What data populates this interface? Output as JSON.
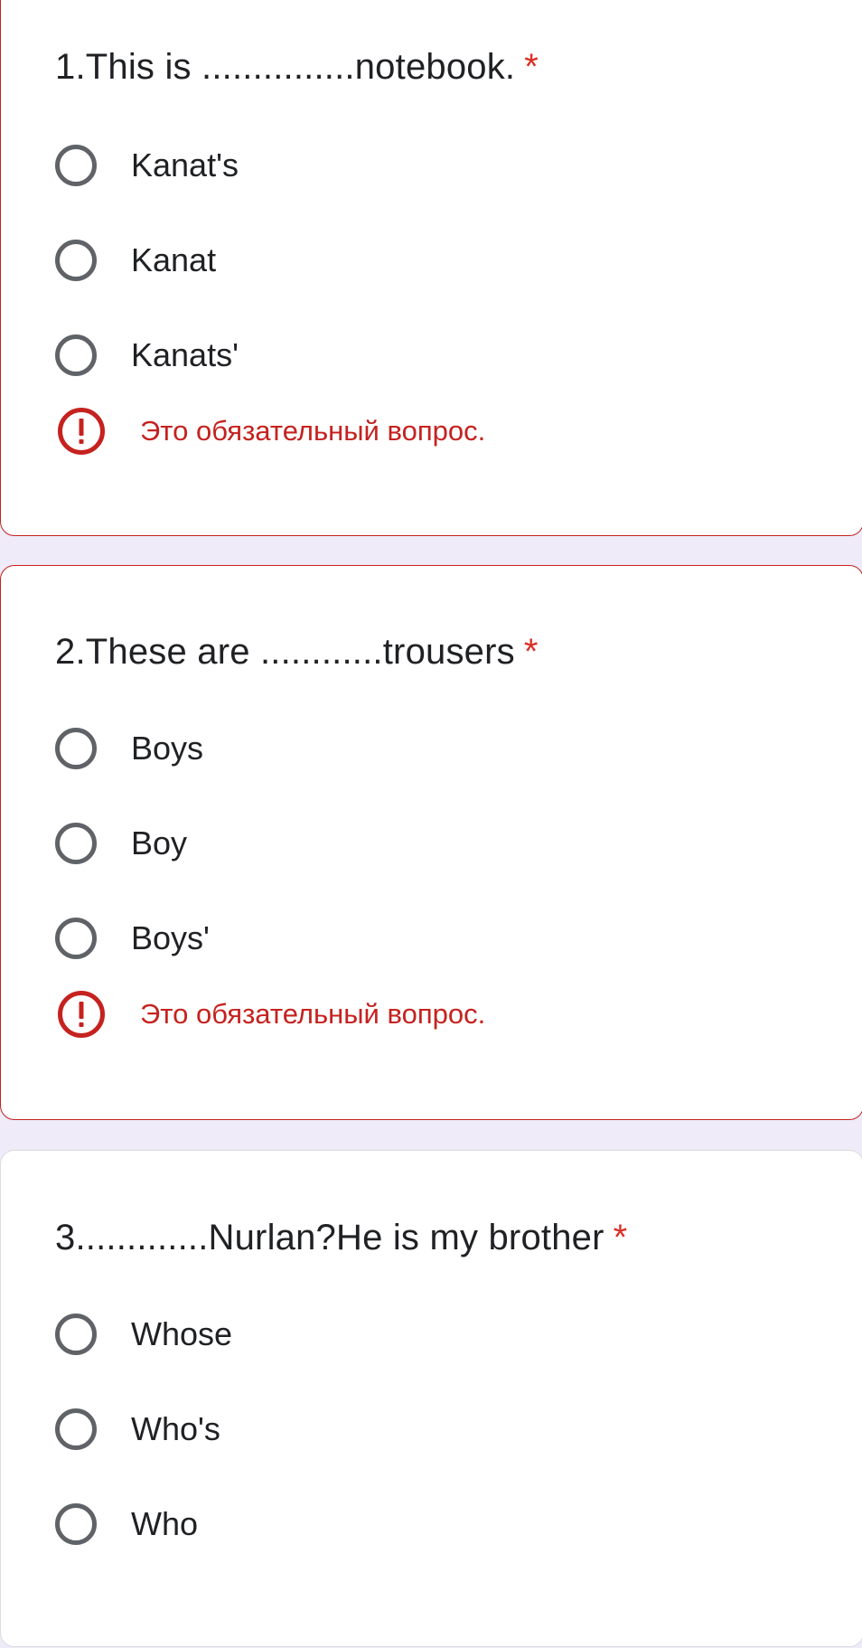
{
  "questions": [
    {
      "title": "1.This is ...............notebook.",
      "required_mark": "*",
      "options": [
        "Kanat's",
        "Kanat",
        "Kanats'"
      ],
      "error": "Это обязательный вопрос."
    },
    {
      "title": "2.These are ............trousers",
      "required_mark": "*",
      "options": [
        "Boys",
        "Boy",
        "Boys'"
      ],
      "error": "Это обязательный вопрос."
    },
    {
      "title": "3.............Nurlan?He is my brother",
      "required_mark": "*",
      "options": [
        "Whose",
        "Who's",
        "Who"
      ]
    }
  ],
  "colors": {
    "page_background": "#efebf8",
    "card_background": "#ffffff",
    "error_red": "#c5221f",
    "required_star": "#d93025",
    "radio_border": "#5f6368",
    "text": "#202124"
  }
}
